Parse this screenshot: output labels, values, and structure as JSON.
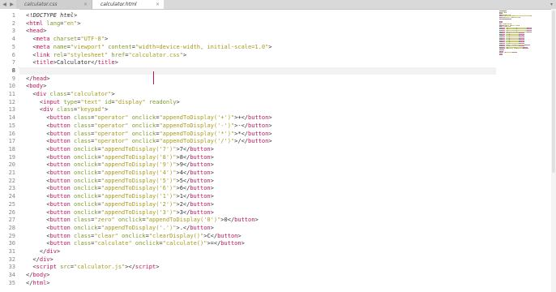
{
  "tabs": [
    {
      "label": "calculator.css",
      "active": false
    },
    {
      "label": "calculator.html",
      "active": true
    }
  ],
  "icons": {
    "nav_back": "◀",
    "nav_forward": "▶",
    "close": "×",
    "dropdown": "▾"
  },
  "colors": {
    "tag": "#c0135c",
    "attribute": "#7a9c28",
    "string": "#a89b1b",
    "text": "#333333"
  },
  "editor": {
    "current_line": 8,
    "lines": [
      [
        [
          "<!",
          ""
        ],
        [
          "DOCTYPE html",
          "doctype"
        ],
        [
          ">",
          ""
        ]
      ],
      [
        [
          "<",
          ""
        ],
        [
          "html",
          "tag"
        ],
        [
          " ",
          ""
        ],
        [
          "lang",
          "attr"
        ],
        [
          "=",
          ""
        ],
        [
          "\"en\"",
          "str"
        ],
        [
          ">",
          ""
        ]
      ],
      [
        [
          "<",
          ""
        ],
        [
          "head",
          "tag"
        ],
        [
          ">",
          ""
        ]
      ],
      [
        [
          "  <",
          ""
        ],
        [
          "meta",
          "tag"
        ],
        [
          " ",
          ""
        ],
        [
          "charset",
          "attr"
        ],
        [
          "=",
          ""
        ],
        [
          "\"UTF-8\"",
          "str"
        ],
        [
          ">",
          ""
        ]
      ],
      [
        [
          "  <",
          ""
        ],
        [
          "meta",
          "tag"
        ],
        [
          " ",
          ""
        ],
        [
          "name",
          "attr"
        ],
        [
          "=",
          ""
        ],
        [
          "\"viewport\"",
          "str"
        ],
        [
          " ",
          ""
        ],
        [
          "content",
          "attr"
        ],
        [
          "=",
          ""
        ],
        [
          "\"width=device-width, initial-scale=1.0\"",
          "str"
        ],
        [
          ">",
          ""
        ]
      ],
      [
        [
          "  <",
          ""
        ],
        [
          "link",
          "tag"
        ],
        [
          " ",
          ""
        ],
        [
          "rel",
          "attr"
        ],
        [
          "=",
          ""
        ],
        [
          "\"stylesheet\"",
          "str"
        ],
        [
          " ",
          ""
        ],
        [
          "href",
          "attr"
        ],
        [
          "=",
          ""
        ],
        [
          "\"calculator.css\"",
          "str"
        ],
        [
          ">",
          ""
        ]
      ],
      [
        [
          "  <",
          ""
        ],
        [
          "title",
          "tag"
        ],
        [
          ">Calculator</",
          ""
        ],
        [
          "title",
          "tag"
        ],
        [
          ">",
          ""
        ]
      ],
      [
        [
          "",
          ""
        ]
      ],
      [
        [
          "</",
          ""
        ],
        [
          "head",
          "tag"
        ],
        [
          ">",
          ""
        ]
      ],
      [
        [
          "<",
          ""
        ],
        [
          "body",
          "tag"
        ],
        [
          ">",
          ""
        ]
      ],
      [
        [
          "  <",
          ""
        ],
        [
          "div",
          "tag"
        ],
        [
          " ",
          ""
        ],
        [
          "class",
          "attr"
        ],
        [
          "=",
          ""
        ],
        [
          "\"calculator\"",
          "str"
        ],
        [
          ">",
          ""
        ]
      ],
      [
        [
          "    <",
          ""
        ],
        [
          "input",
          "tag"
        ],
        [
          " ",
          ""
        ],
        [
          "type",
          "attr"
        ],
        [
          "=",
          ""
        ],
        [
          "\"text\"",
          "str"
        ],
        [
          " ",
          ""
        ],
        [
          "id",
          "attr"
        ],
        [
          "=",
          ""
        ],
        [
          "\"display\"",
          "str"
        ],
        [
          " ",
          ""
        ],
        [
          "readonly",
          "attr"
        ],
        [
          ">",
          ""
        ]
      ],
      [
        [
          "    <",
          ""
        ],
        [
          "div",
          "tag"
        ],
        [
          " ",
          ""
        ],
        [
          "class",
          "attr"
        ],
        [
          "=",
          ""
        ],
        [
          "\"keypad\"",
          "str"
        ],
        [
          ">",
          ""
        ]
      ],
      [
        [
          "      <",
          ""
        ],
        [
          "button",
          "tag"
        ],
        [
          " ",
          ""
        ],
        [
          "class",
          "attr"
        ],
        [
          "=",
          ""
        ],
        [
          "\"operator\"",
          "str"
        ],
        [
          " ",
          ""
        ],
        [
          "onclick",
          "attr"
        ],
        [
          "=",
          ""
        ],
        [
          "\"appendToDisplay('+')\"",
          "str"
        ],
        [
          ">+</",
          ""
        ],
        [
          "button",
          "tag"
        ],
        [
          ">",
          ""
        ]
      ],
      [
        [
          "      <",
          ""
        ],
        [
          "button",
          "tag"
        ],
        [
          " ",
          ""
        ],
        [
          "class",
          "attr"
        ],
        [
          "=",
          ""
        ],
        [
          "\"operator\"",
          "str"
        ],
        [
          " ",
          ""
        ],
        [
          "onclick",
          "attr"
        ],
        [
          "=",
          ""
        ],
        [
          "\"appendToDisplay('-')\"",
          "str"
        ],
        [
          ">-</",
          ""
        ],
        [
          "button",
          "tag"
        ],
        [
          ">",
          ""
        ]
      ],
      [
        [
          "      <",
          ""
        ],
        [
          "button",
          "tag"
        ],
        [
          " ",
          ""
        ],
        [
          "class",
          "attr"
        ],
        [
          "=",
          ""
        ],
        [
          "\"operator\"",
          "str"
        ],
        [
          " ",
          ""
        ],
        [
          "onclick",
          "attr"
        ],
        [
          "=",
          ""
        ],
        [
          "\"appendToDisplay('*')\"",
          "str"
        ],
        [
          ">*</",
          ""
        ],
        [
          "button",
          "tag"
        ],
        [
          ">",
          ""
        ]
      ],
      [
        [
          "      <",
          ""
        ],
        [
          "button",
          "tag"
        ],
        [
          " ",
          ""
        ],
        [
          "class",
          "attr"
        ],
        [
          "=",
          ""
        ],
        [
          "\"operator\"",
          "str"
        ],
        [
          " ",
          ""
        ],
        [
          "onclick",
          "attr"
        ],
        [
          "=",
          ""
        ],
        [
          "\"appendToDisplay('/')\"",
          "str"
        ],
        [
          ">/</",
          ""
        ],
        [
          "button",
          "tag"
        ],
        [
          ">",
          ""
        ]
      ],
      [
        [
          "      <",
          ""
        ],
        [
          "button",
          "tag"
        ],
        [
          " ",
          ""
        ],
        [
          "onclick",
          "attr"
        ],
        [
          "=",
          ""
        ],
        [
          "\"appendToDisplay('7')\"",
          "str"
        ],
        [
          ">7</",
          ""
        ],
        [
          "button",
          "tag"
        ],
        [
          ">",
          ""
        ]
      ],
      [
        [
          "      <",
          ""
        ],
        [
          "button",
          "tag"
        ],
        [
          " ",
          ""
        ],
        [
          "onclick",
          "attr"
        ],
        [
          "=",
          ""
        ],
        [
          "\"appendToDisplay('8')\"",
          "str"
        ],
        [
          ">8</",
          ""
        ],
        [
          "button",
          "tag"
        ],
        [
          ">",
          ""
        ]
      ],
      [
        [
          "      <",
          ""
        ],
        [
          "button",
          "tag"
        ],
        [
          " ",
          ""
        ],
        [
          "onclick",
          "attr"
        ],
        [
          "=",
          ""
        ],
        [
          "\"appendToDisplay('9')\"",
          "str"
        ],
        [
          ">9</",
          ""
        ],
        [
          "button",
          "tag"
        ],
        [
          ">",
          ""
        ]
      ],
      [
        [
          "      <",
          ""
        ],
        [
          "button",
          "tag"
        ],
        [
          " ",
          ""
        ],
        [
          "onclick",
          "attr"
        ],
        [
          "=",
          ""
        ],
        [
          "\"appendToDisplay('4')\"",
          "str"
        ],
        [
          ">4</",
          ""
        ],
        [
          "button",
          "tag"
        ],
        [
          ">",
          ""
        ]
      ],
      [
        [
          "      <",
          ""
        ],
        [
          "button",
          "tag"
        ],
        [
          " ",
          ""
        ],
        [
          "onclick",
          "attr"
        ],
        [
          "=",
          ""
        ],
        [
          "\"appendToDisplay('5')\"",
          "str"
        ],
        [
          ">5</",
          ""
        ],
        [
          "button",
          "tag"
        ],
        [
          ">",
          ""
        ]
      ],
      [
        [
          "      <",
          ""
        ],
        [
          "button",
          "tag"
        ],
        [
          " ",
          ""
        ],
        [
          "onclick",
          "attr"
        ],
        [
          "=",
          ""
        ],
        [
          "\"appendToDisplay('6')\"",
          "str"
        ],
        [
          ">6</",
          ""
        ],
        [
          "button",
          "tag"
        ],
        [
          ">",
          ""
        ]
      ],
      [
        [
          "      <",
          ""
        ],
        [
          "button",
          "tag"
        ],
        [
          " ",
          ""
        ],
        [
          "onclick",
          "attr"
        ],
        [
          "=",
          ""
        ],
        [
          "\"appendToDisplay('1')\"",
          "str"
        ],
        [
          ">1</",
          ""
        ],
        [
          "button",
          "tag"
        ],
        [
          ">",
          ""
        ]
      ],
      [
        [
          "      <",
          ""
        ],
        [
          "button",
          "tag"
        ],
        [
          " ",
          ""
        ],
        [
          "onclick",
          "attr"
        ],
        [
          "=",
          ""
        ],
        [
          "\"appendToDisplay('2')\"",
          "str"
        ],
        [
          ">2</",
          ""
        ],
        [
          "button",
          "tag"
        ],
        [
          ">",
          ""
        ]
      ],
      [
        [
          "      <",
          ""
        ],
        [
          "button",
          "tag"
        ],
        [
          " ",
          ""
        ],
        [
          "onclick",
          "attr"
        ],
        [
          "=",
          ""
        ],
        [
          "\"appendToDisplay('3')\"",
          "str"
        ],
        [
          ">3</",
          ""
        ],
        [
          "button",
          "tag"
        ],
        [
          ">",
          ""
        ]
      ],
      [
        [
          "      <",
          ""
        ],
        [
          "button",
          "tag"
        ],
        [
          " ",
          ""
        ],
        [
          "class",
          "attr"
        ],
        [
          "=",
          ""
        ],
        [
          "\"zero\"",
          "str"
        ],
        [
          " ",
          ""
        ],
        [
          "onclick",
          "attr"
        ],
        [
          "=",
          ""
        ],
        [
          "\"appendToDisplay('0')\"",
          "str"
        ],
        [
          ">0</",
          ""
        ],
        [
          "button",
          "tag"
        ],
        [
          ">",
          ""
        ]
      ],
      [
        [
          "      <",
          ""
        ],
        [
          "button",
          "tag"
        ],
        [
          " ",
          ""
        ],
        [
          "onclick",
          "attr"
        ],
        [
          "=",
          ""
        ],
        [
          "\"appendToDisplay('.')\"",
          "str"
        ],
        [
          ">.</",
          ""
        ],
        [
          "button",
          "tag"
        ],
        [
          ">",
          ""
        ]
      ],
      [
        [
          "      <",
          ""
        ],
        [
          "button",
          "tag"
        ],
        [
          " ",
          ""
        ],
        [
          "class",
          "attr"
        ],
        [
          "=",
          ""
        ],
        [
          "\"clear\"",
          "str"
        ],
        [
          " ",
          ""
        ],
        [
          "onclick",
          "attr"
        ],
        [
          "=",
          ""
        ],
        [
          "\"clearDisplay()\"",
          "str"
        ],
        [
          ">C</",
          ""
        ],
        [
          "button",
          "tag"
        ],
        [
          ">",
          ""
        ]
      ],
      [
        [
          "      <",
          ""
        ],
        [
          "button",
          "tag"
        ],
        [
          " ",
          ""
        ],
        [
          "class",
          "attr"
        ],
        [
          "=",
          ""
        ],
        [
          "\"calculate\"",
          "str"
        ],
        [
          " ",
          ""
        ],
        [
          "onclick",
          "attr"
        ],
        [
          "=",
          ""
        ],
        [
          "\"calculate()\"",
          "str"
        ],
        [
          ">=</",
          ""
        ],
        [
          "button",
          "tag"
        ],
        [
          ">",
          ""
        ]
      ],
      [
        [
          "    </",
          ""
        ],
        [
          "div",
          "tag"
        ],
        [
          ">",
          ""
        ]
      ],
      [
        [
          "  </",
          ""
        ],
        [
          "div",
          "tag"
        ],
        [
          ">",
          ""
        ]
      ],
      [
        [
          "  <",
          ""
        ],
        [
          "script",
          "tag"
        ],
        [
          " ",
          ""
        ],
        [
          "src",
          "attr"
        ],
        [
          "=",
          ""
        ],
        [
          "\"calculator.js\"",
          "str"
        ],
        [
          "></",
          ""
        ],
        [
          "script",
          "tag"
        ],
        [
          ">",
          ""
        ]
      ],
      [
        [
          "</",
          ""
        ],
        [
          "body",
          "tag"
        ],
        [
          ">",
          ""
        ]
      ],
      [
        [
          "</",
          ""
        ],
        [
          "html",
          "tag"
        ],
        [
          ">",
          ""
        ]
      ]
    ]
  }
}
